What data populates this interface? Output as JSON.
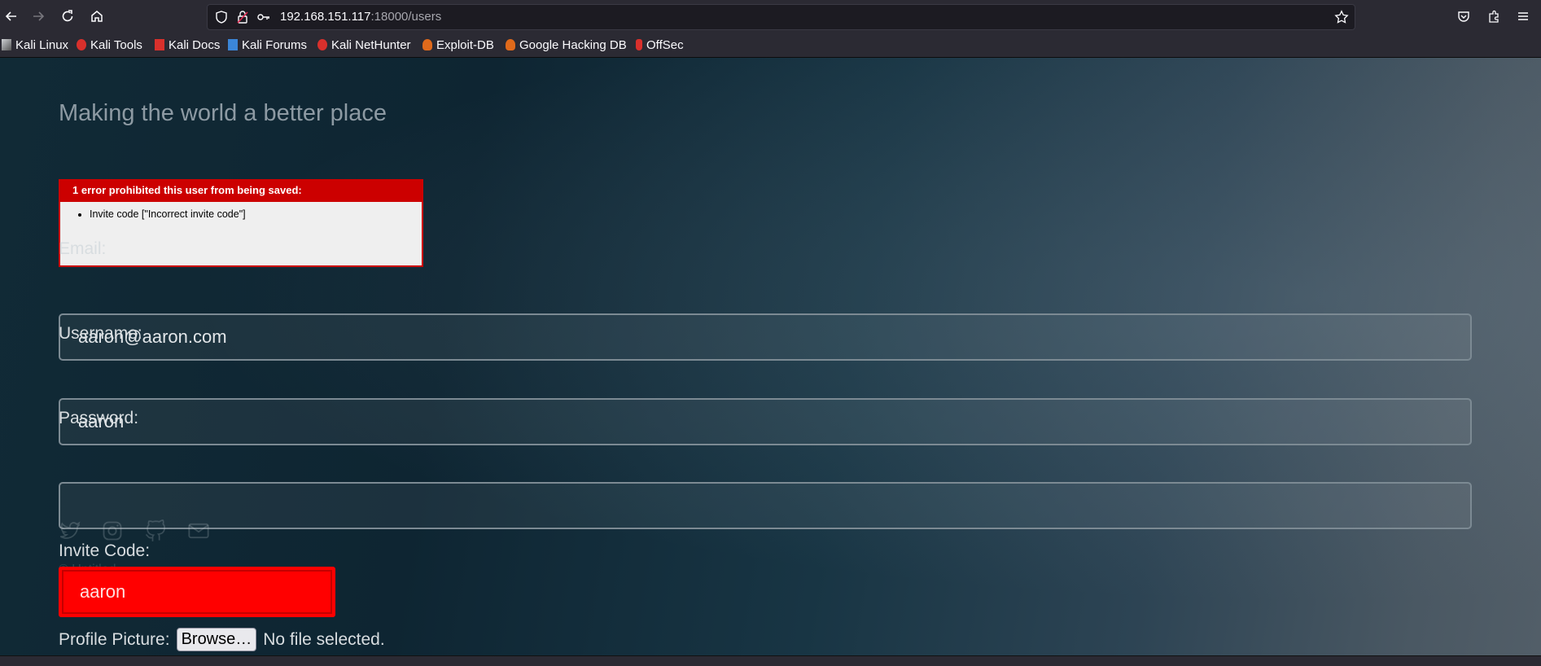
{
  "browser": {
    "url_host": "192.168.151.117",
    "url_rest": ":18000/users",
    "icons": [
      "back-icon",
      "forward-icon",
      "reload-icon",
      "home-icon",
      "shield-icon",
      "lock-icon",
      "key-icon",
      "star-icon",
      "pocket-icon",
      "extensions-icon",
      "menu-icon"
    ]
  },
  "bookmarks": [
    {
      "label": "Kali Linux",
      "icon": "kali-dragon-icon",
      "color": "#cfd2d6"
    },
    {
      "label": "Kali Tools",
      "icon": "kali-tools-icon",
      "color": "#d9302c"
    },
    {
      "label": "Kali Docs",
      "icon": "kali-docs-icon",
      "color": "#d9302c"
    },
    {
      "label": "Kali Forums",
      "icon": "kali-forums-icon",
      "color": "#3b86d8"
    },
    {
      "label": "Kali NetHunter",
      "icon": "kali-nethunter-icon",
      "color": "#d9302c"
    },
    {
      "label": "Exploit-DB",
      "icon": "exploit-db-icon",
      "color": "#e06a1b"
    },
    {
      "label": "Google Hacking DB",
      "icon": "ghdb-icon",
      "color": "#e06a1b"
    },
    {
      "label": "OffSec",
      "icon": "offsec-icon",
      "color": "#d9302c"
    }
  ],
  "page": {
    "tagline": "Making the world a better place",
    "error": {
      "header": "1 error prohibited this user from being saved:",
      "items": [
        "Invite code [\"Incorrect invite code\"]"
      ]
    },
    "form": {
      "email_label": "Email:",
      "email_value": "aaron@aaron.com",
      "username_label": "Username:",
      "username_value": "aaron",
      "password_label": "Password:",
      "password_value": "",
      "invite_label": "Invite Code:",
      "invite_value": "aaron",
      "picture_label": "Profile Picture:",
      "browse_label": "Browse…",
      "no_file_text": "No file selected."
    },
    "ghost_text": "© Untitled.",
    "social_icons": [
      "twitter-icon",
      "instagram-icon",
      "github-icon",
      "mail-icon"
    ]
  },
  "colors": {
    "error_red": "#cc0000",
    "invite_field_red": "#ff0000"
  }
}
